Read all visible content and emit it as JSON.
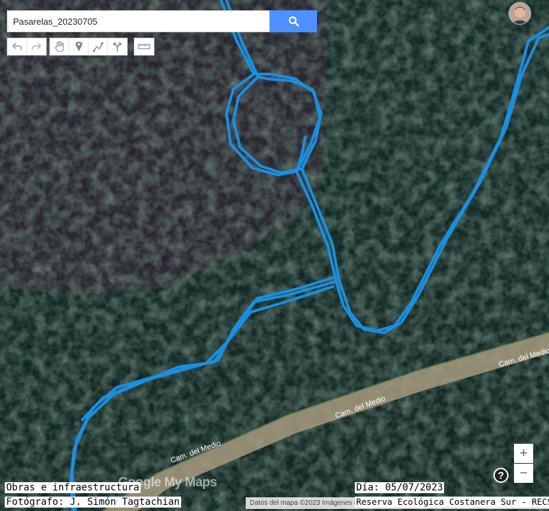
{
  "search": {
    "value": "Pasarelas_20230705",
    "button_icon": "search-icon"
  },
  "toolbar": {
    "history": [
      {
        "name": "undo-icon"
      },
      {
        "name": "redo-icon"
      }
    ],
    "tools": [
      {
        "name": "hand-pan-icon"
      },
      {
        "name": "add-marker-icon"
      },
      {
        "name": "draw-line-icon"
      },
      {
        "name": "directions-icon"
      }
    ],
    "measure": {
      "name": "ruler-icon"
    }
  },
  "map": {
    "imagery": "satellite",
    "track_color": "#1a8fe0",
    "road_labels": [
      "Cam. del Medio",
      "Cam. del Medio",
      "Cam. del Medio"
    ]
  },
  "zoom": {
    "in_label": "+",
    "out_label": "−"
  },
  "help": {
    "label": "?"
  },
  "logo": {
    "text": "Google My Maps"
  },
  "attribution": "Datos del mapa ©2023 Imágenes ©",
  "captions": {
    "category": "Obras e infraestructura",
    "photographer": "Fotógrafo: J. Simón Tagtachian",
    "date": "Día: 05/07/2023",
    "organization": "Reserva Ecológica Costanera Sur - RECS"
  }
}
